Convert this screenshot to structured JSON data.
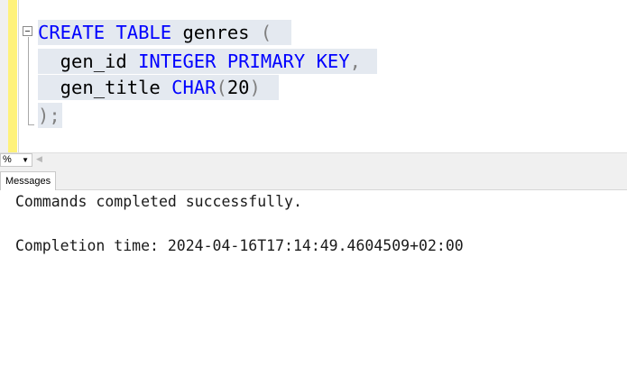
{
  "editor": {
    "lines": [
      [
        {
          "text": "CREATE",
          "cls": "kw"
        },
        {
          "text": " ",
          "cls": "ident"
        },
        {
          "text": "TABLE",
          "cls": "kw"
        },
        {
          "text": " genres ",
          "cls": "ident"
        },
        {
          "text": "(",
          "cls": "punc"
        }
      ],
      [
        {
          "text": "  gen_id ",
          "cls": "ident"
        },
        {
          "text": "INTEGER",
          "cls": "kw"
        },
        {
          "text": " ",
          "cls": "ident"
        },
        {
          "text": "PRIMARY",
          "cls": "kw"
        },
        {
          "text": " ",
          "cls": "ident"
        },
        {
          "text": "KEY",
          "cls": "kw"
        },
        {
          "text": ",",
          "cls": "punc"
        }
      ],
      [
        {
          "text": "  gen_title ",
          "cls": "ident"
        },
        {
          "text": "CHAR",
          "cls": "kw"
        },
        {
          "text": "(",
          "cls": "punc"
        },
        {
          "text": "20",
          "cls": "num"
        },
        {
          "text": ")",
          "cls": "punc"
        }
      ],
      [
        {
          "text": ");",
          "cls": "punc"
        }
      ]
    ]
  },
  "zoom": {
    "value": "%",
    "dropdown_icon": "caret-down-icon"
  },
  "results": {
    "tab_label": "Messages",
    "messages": [
      "Commands completed successfully.",
      "Completion time: 2024-04-16T17:14:49.4604509+02:00"
    ]
  }
}
